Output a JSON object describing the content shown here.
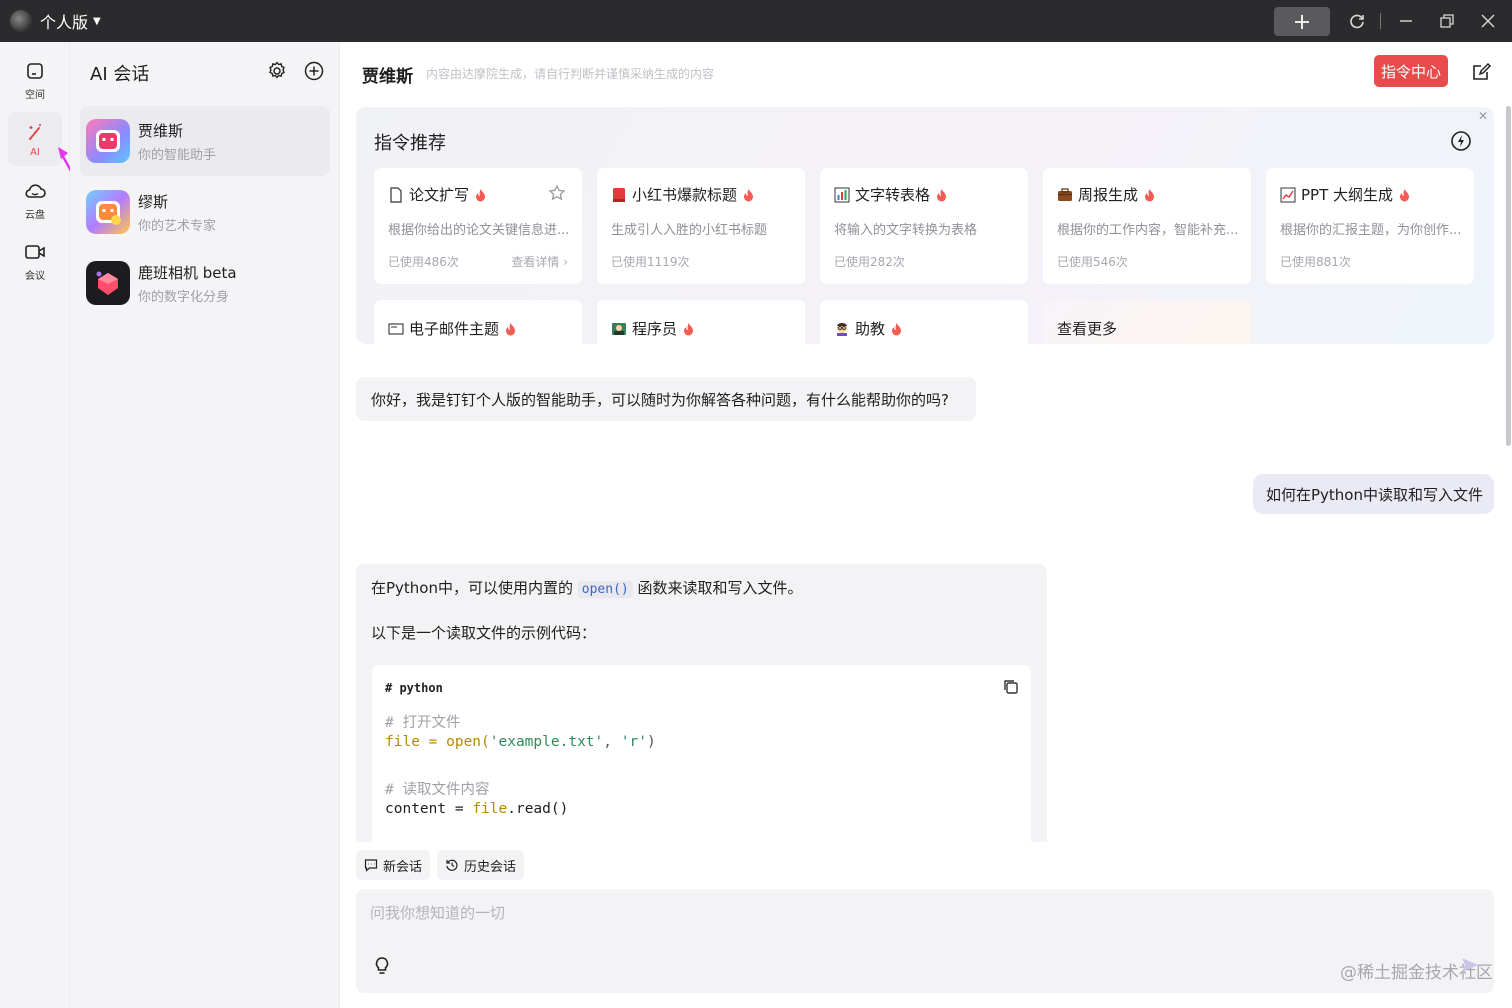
{
  "titlebar": {
    "title": "个人版",
    "buttons": [
      "new-tab",
      "refresh",
      "minimize",
      "restore",
      "close"
    ]
  },
  "nav": {
    "items": [
      {
        "label": "空间",
        "icon": "space-icon"
      },
      {
        "label": "AI",
        "icon": "ai-wand-icon",
        "active": true
      },
      {
        "label": "云盘",
        "icon": "cloud-icon"
      },
      {
        "label": "会议",
        "icon": "video-icon"
      }
    ],
    "accent": "#e8484a"
  },
  "sessions": {
    "title": "AI 会话",
    "items": [
      {
        "name": "贾维斯",
        "desc": "你的智能助手",
        "active": true
      },
      {
        "name": "缪斯",
        "desc": "你的艺术专家"
      },
      {
        "name": "鹿班相机 beta",
        "desc": "你的数字化分身"
      }
    ]
  },
  "main": {
    "header": {
      "name": "贾维斯",
      "note": "内容由达摩院生成，请自行判断并谨慎采纳生成的内容",
      "cmd_center": "指令中心"
    },
    "recommend": {
      "title": "指令推荐",
      "cards": [
        {
          "title": "论文扩写",
          "desc": "根据你给出的论文关键信息进...",
          "used": "已使用486次",
          "detail": "查看详情 ›"
        },
        {
          "title": "小红书爆款标题",
          "desc": "生成引人入胜的小红书标题",
          "used": "已使用1119次"
        },
        {
          "title": "文字转表格",
          "desc": "将输入的文字转换为表格",
          "used": "已使用282次"
        },
        {
          "title": "周报生成",
          "desc": "根据你的工作内容，智能补充...",
          "used": "已使用546次"
        },
        {
          "title": "PPT 大纲生成",
          "desc": "根据你的汇报主题，为你创作...",
          "used": "已使用881次"
        }
      ],
      "row2": [
        {
          "title": "电子邮件主题"
        },
        {
          "title": "程序员"
        },
        {
          "title": "助教"
        },
        {
          "title": "查看更多"
        }
      ]
    },
    "chat": {
      "greeting": "你好，我是钉钉个人版的智能助手，可以随时为你解答各种问题，有什么能帮助你的吗?",
      "user_msg": "如何在Python中读取和写入文件",
      "answer_pre": "在Python中，可以使用内置的",
      "answer_code": "open()",
      "answer_post": "函数来读取和写入文件。",
      "answer_line2": "以下是一个读取文件的示例代码：",
      "code": {
        "lang": "# python",
        "c1": "# 打开文件",
        "l2_var": "file",
        "l2_eq": " = open(",
        "l2_str1": "'example.txt'",
        "l2_comma": ", ",
        "l2_str2": "'r'",
        "l2_close": ")",
        "c2": "# 读取文件内容",
        "l5_plain": "content = ",
        "l5_var": "file",
        "l5_rest": ".read()"
      }
    },
    "bottom": {
      "new_chat": "新会话",
      "history": "历史会话",
      "placeholder": "问我你想知道的一切",
      "watermark": "@稀土掘金技术社区"
    }
  }
}
